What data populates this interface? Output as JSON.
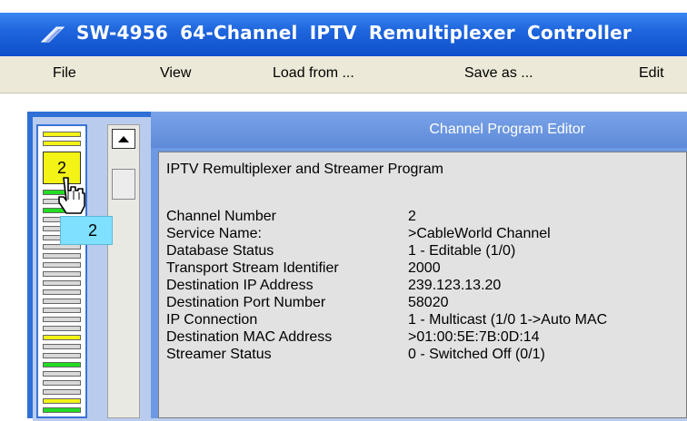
{
  "window": {
    "title": "SW-4956  64-Channel  IPTV  Remultiplexer  Controller"
  },
  "menu": {
    "items": [
      "File",
      "View",
      "Load from ...",
      "Save as ...",
      "Edit"
    ]
  },
  "channels": {
    "selected_number": "2",
    "tooltip_number": "2"
  },
  "editor": {
    "panel_title": "Channel Program Editor",
    "heading": "IPTV Remultiplexer and Streamer Program",
    "fields": [
      {
        "label": "Channel Number",
        "value": "2"
      },
      {
        "label": "Service Name:",
        "value": ">CableWorld Channel"
      },
      {
        "label": "Database Status",
        "value": "1 - Editable (1/0)"
      },
      {
        "label": "Transport Stream Identifier",
        "value": "2000"
      },
      {
        "label": "Destination IP Address",
        "value": "239.123.13.20"
      },
      {
        "label": "Destination Port Number",
        "value": "58020"
      },
      {
        "label": "IP Connection",
        "value": "1 - Multicast (1/0 1->Auto MAC"
      },
      {
        "label": "Destination MAC Address",
        "value": ">01:00:5E:7B:0D:14"
      },
      {
        "label": "Streamer Status",
        "value": "0 - Switched Off  (0/1)"
      }
    ]
  },
  "colors": {
    "titlebar": "#1f66de",
    "selected_channel": "#f3f316",
    "active_channel": "#22dd22",
    "tooltip": "#7fe0ff"
  }
}
